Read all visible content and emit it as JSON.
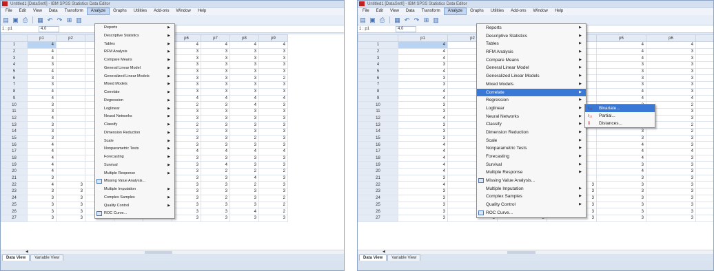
{
  "window": {
    "title": "Untitled1 [DataSet0] - IBM SPSS Statistics Data Editor",
    "menus": [
      "File",
      "Edit",
      "View",
      "Data",
      "Transform",
      "Analyze",
      "Graphs",
      "Utilities",
      "Add-ons",
      "Window",
      "Help"
    ],
    "active_menu": "Analyze",
    "cell_ref": "1 : p1",
    "cell_value": "4.0"
  },
  "columns_left": [
    "",
    "p1",
    "p2",
    "",
    "",
    "p5",
    "p6",
    "p7",
    "p8",
    "p9"
  ],
  "columns_right": [
    "",
    "p1",
    "p2",
    "",
    "",
    "p5",
    "p6",
    "p7"
  ],
  "rows": [
    {
      "n": "1",
      "v": [
        "4",
        "",
        "",
        "",
        "4",
        "4",
        "4",
        "4",
        "4"
      ]
    },
    {
      "n": "2",
      "v": [
        "4",
        "",
        "",
        "",
        "4",
        "3",
        "3",
        "3",
        "3"
      ]
    },
    {
      "n": "3",
      "v": [
        "4",
        "",
        "",
        "",
        "4",
        "3",
        "3",
        "3",
        "3"
      ]
    },
    {
      "n": "4",
      "v": [
        "3",
        "",
        "",
        "",
        "3",
        "3",
        "3",
        "3",
        "3"
      ]
    },
    {
      "n": "5",
      "v": [
        "4",
        "",
        "",
        "",
        "3",
        "3",
        "3",
        "3",
        "3"
      ]
    },
    {
      "n": "6",
      "v": [
        "3",
        "",
        "",
        "",
        "3",
        "3",
        "3",
        "3",
        "2"
      ]
    },
    {
      "n": "7",
      "v": [
        "3",
        "",
        "",
        "",
        "3",
        "3",
        "3",
        "3",
        "3"
      ]
    },
    {
      "n": "8",
      "v": [
        "4",
        "",
        "",
        "",
        "4",
        "3",
        "3",
        "3",
        "3"
      ]
    },
    {
      "n": "9",
      "v": [
        "4",
        "",
        "",
        "",
        "4",
        "4",
        "4",
        "4",
        "4"
      ]
    },
    {
      "n": "10",
      "v": [
        "3",
        "",
        "",
        "",
        "3",
        "2",
        "3",
        "4",
        "3"
      ]
    },
    {
      "n": "11",
      "v": [
        "3",
        "",
        "",
        "",
        "2",
        "3",
        "3",
        "3",
        "3"
      ]
    },
    {
      "n": "12",
      "v": [
        "4",
        "",
        "",
        "",
        "3",
        "3",
        "3",
        "3",
        "3"
      ]
    },
    {
      "n": "13",
      "v": [
        "3",
        "",
        "",
        "",
        "3",
        "2",
        "3",
        "3",
        "3"
      ]
    },
    {
      "n": "14",
      "v": [
        "3",
        "",
        "",
        "",
        "3",
        "2",
        "3",
        "3",
        "3"
      ]
    },
    {
      "n": "15",
      "v": [
        "3",
        "",
        "",
        "",
        "3",
        "3",
        "3",
        "2",
        "3"
      ]
    },
    {
      "n": "16",
      "v": [
        "4",
        "",
        "",
        "",
        "4",
        "3",
        "3",
        "3",
        "3"
      ]
    },
    {
      "n": "17",
      "v": [
        "4",
        "",
        "",
        "",
        "4",
        "4",
        "4",
        "4",
        "4"
      ]
    },
    {
      "n": "18",
      "v": [
        "4",
        "",
        "",
        "",
        "4",
        "3",
        "3",
        "3",
        "3"
      ]
    },
    {
      "n": "19",
      "v": [
        "4",
        "",
        "",
        "",
        "3",
        "3",
        "4",
        "3",
        "3"
      ]
    },
    {
      "n": "20",
      "v": [
        "4",
        "",
        "",
        "",
        "4",
        "3",
        "2",
        "2",
        "2"
      ]
    },
    {
      "n": "21",
      "v": [
        "3",
        "",
        "",
        "",
        "3",
        "3",
        "3",
        "4",
        "3"
      ]
    },
    {
      "n": "22",
      "v": [
        "4",
        "3",
        "3",
        "3",
        "3",
        "3",
        "3",
        "2",
        "3"
      ]
    },
    {
      "n": "23",
      "v": [
        "3",
        "3",
        "3",
        "3",
        "3",
        "3",
        "3",
        "3",
        "3"
      ]
    },
    {
      "n": "24",
      "v": [
        "3",
        "3",
        "3",
        "3",
        "3",
        "3",
        "2",
        "3",
        "2"
      ]
    },
    {
      "n": "25",
      "v": [
        "3",
        "3",
        "4",
        "3",
        "3",
        "3",
        "3",
        "3",
        "2"
      ]
    },
    {
      "n": "26",
      "v": [
        "3",
        "3",
        "3",
        "3",
        "3",
        "3",
        "3",
        "4",
        "2"
      ]
    },
    {
      "n": "27",
      "v": [
        "3",
        "3",
        "3",
        "3",
        "3",
        "3",
        "3",
        "3",
        "3"
      ]
    }
  ],
  "analyze_menu": [
    {
      "label": "Reports",
      "sub": true
    },
    {
      "label": "Descriptive Statistics",
      "sub": true
    },
    {
      "label": "Tables",
      "sub": true
    },
    {
      "label": "RFM Analysis",
      "sub": true
    },
    {
      "label": "Compare Means",
      "sub": true
    },
    {
      "label": "General Linear Model",
      "sub": true
    },
    {
      "label": "Generalized Linear Models",
      "sub": true
    },
    {
      "label": "Mixed Models",
      "sub": true
    },
    {
      "label": "Correlate",
      "sub": true
    },
    {
      "label": "Regression",
      "sub": true
    },
    {
      "label": "Loglinear",
      "sub": true
    },
    {
      "label": "Neural Networks",
      "sub": true
    },
    {
      "label": "Classify",
      "sub": true
    },
    {
      "label": "Dimension Reduction",
      "sub": true
    },
    {
      "label": "Scale",
      "sub": true
    },
    {
      "label": "Nonparametric Tests",
      "sub": true
    },
    {
      "label": "Forecasting",
      "sub": true
    },
    {
      "label": "Survival",
      "sub": true
    },
    {
      "label": "Multiple Response",
      "sub": true
    },
    {
      "label": "Missing Value Analysis...",
      "sub": false,
      "icon": true
    },
    {
      "label": "Multiple Imputation",
      "sub": true
    },
    {
      "label": "Complex Samples",
      "sub": true
    },
    {
      "label": "Quality Control",
      "sub": true
    },
    {
      "label": "ROC Curve...",
      "sub": false,
      "icon": true
    }
  ],
  "correlate_submenu": [
    {
      "label": "Bivariate...",
      "icon": "r₁₂"
    },
    {
      "label": "Partial...",
      "icon": "r₁₂"
    },
    {
      "label": "Distances...",
      "icon": "δ"
    }
  ],
  "tabs": {
    "data_view": "Data View",
    "variable_view": "Variable View"
  }
}
